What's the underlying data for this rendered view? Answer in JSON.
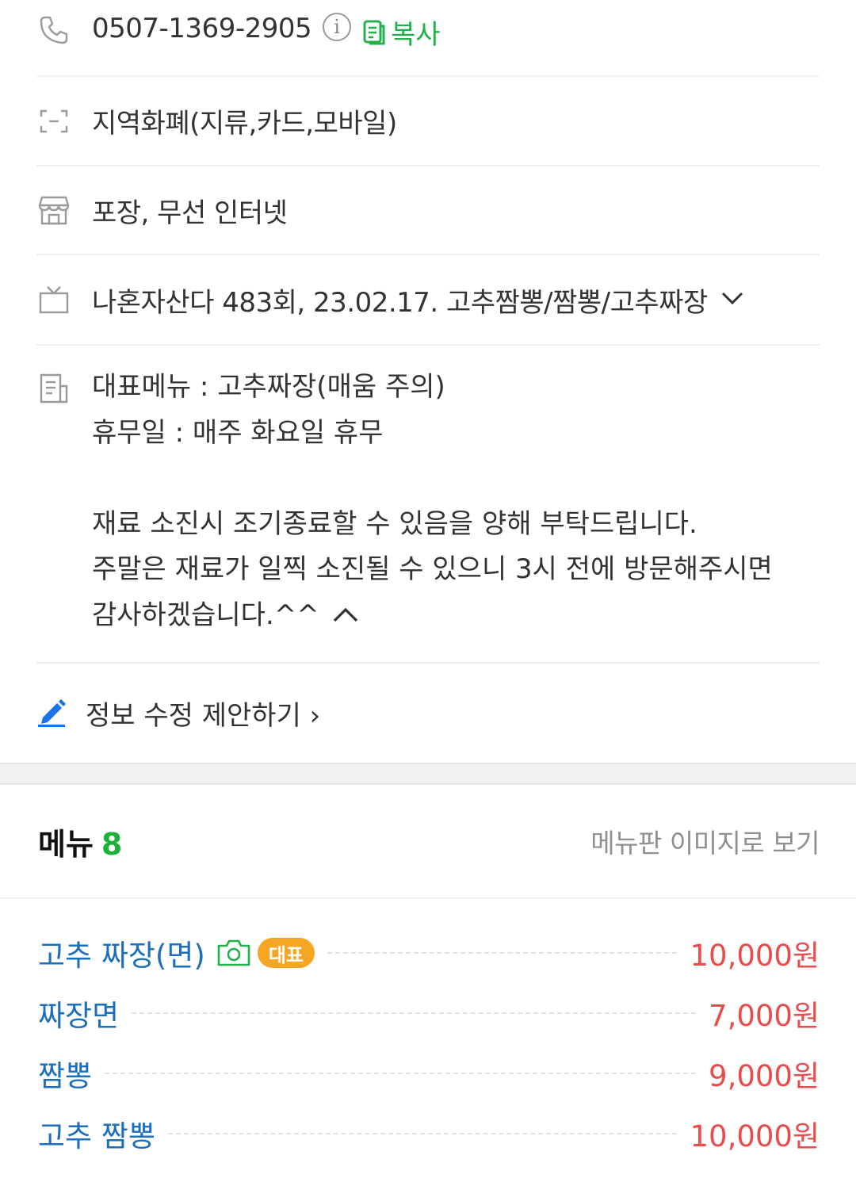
{
  "info": {
    "phone": "0507-1369-2905",
    "info_glyph": "i",
    "copy_label": "복사",
    "payment": "지역화폐(지류,카드,모바일)",
    "facilities": "포장, 무선 인터넷",
    "tv_appearance": "나혼자산다 483회, 23.02.17. 고추짬뽕/짬뽕/고추짜장",
    "description": [
      "대표메뉴 : 고추짜장(매움 주의)",
      "휴무일 : 매주 화요일 휴무",
      "",
      "재료 소진시 조기종료할 수 있음을 양해 부탁드립니다.",
      "주말은 재료가 일찍 소진될 수 있으니 3시 전에 방문해주시면",
      "감사하겠습니다.^^"
    ],
    "suggest_label": "정보 수정 제안하기",
    "suggest_arrow": "›"
  },
  "menu": {
    "title": "메뉴",
    "count": "8",
    "image_link": "메뉴판 이미지로 보기",
    "badge_label": "대표",
    "items": [
      {
        "name": "고추 짜장(면)",
        "price": "10,000원"
      },
      {
        "name": "짜장면",
        "price": "7,000원"
      },
      {
        "name": "짬뽕",
        "price": "9,000원"
      },
      {
        "name": "고추 짬뽕",
        "price": "10,000원"
      }
    ]
  },
  "colors": {
    "accent_green": "#21b14b",
    "menu_name_blue": "#1b6fbd",
    "price_red": "#ea4b4b",
    "badge_orange": "#f6a623",
    "pencil_blue": "#1a73e8"
  },
  "icons": [
    "phone-icon",
    "info-icon",
    "copy-icon",
    "payment-icon",
    "store-icon",
    "tv-icon",
    "chevron-down-icon",
    "document-icon",
    "chevron-up-icon",
    "pencil-icon",
    "camera-icon"
  ]
}
